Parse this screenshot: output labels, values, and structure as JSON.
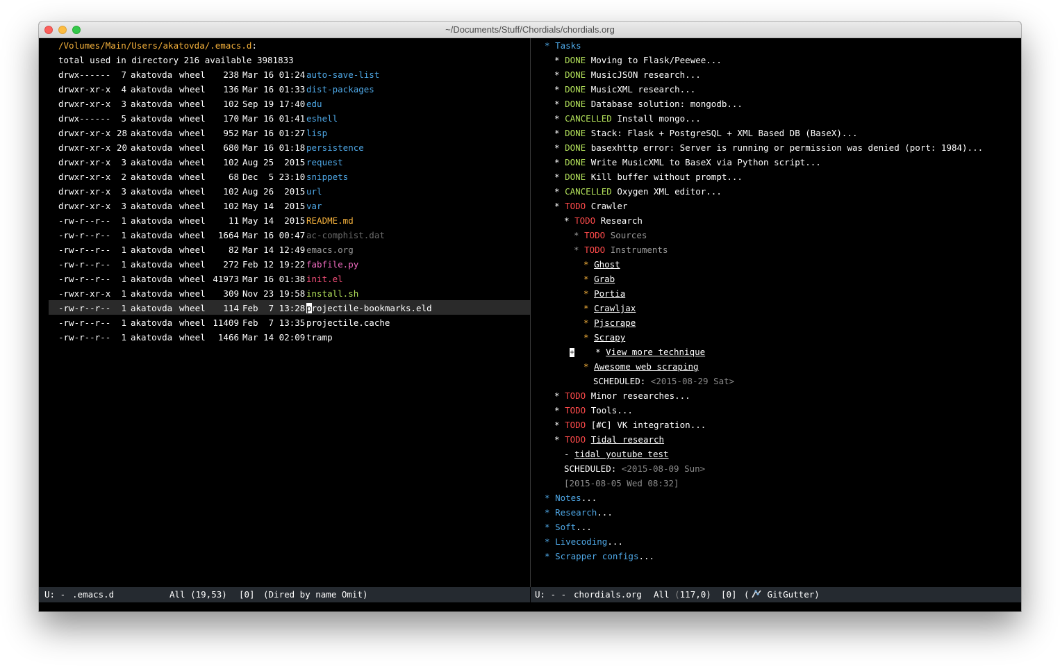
{
  "window": {
    "title": "~/Documents/Stuff/Chordials/chordials.org"
  },
  "dired": {
    "path": "/Volumes/Main/Users/akatovda/.emacs.d",
    "path_colon": ":",
    "summary": "total used in directory 216 available 3981833",
    "rows": [
      {
        "perm": "drwx------",
        "n": "7",
        "owner": "akatovda",
        "group": "wheel",
        "size": "238",
        "date": "Mar 16 01:24",
        "name": "auto-save-list",
        "kind": "dir"
      },
      {
        "perm": "drwxr-xr-x",
        "n": "4",
        "owner": "akatovda",
        "group": "wheel",
        "size": "136",
        "date": "Mar 16 01:33",
        "name": "dist-packages",
        "kind": "dir"
      },
      {
        "perm": "drwxr-xr-x",
        "n": "3",
        "owner": "akatovda",
        "group": "wheel",
        "size": "102",
        "date": "Sep 19 17:40",
        "name": "edu",
        "kind": "dir"
      },
      {
        "perm": "drwx------",
        "n": "5",
        "owner": "akatovda",
        "group": "wheel",
        "size": "170",
        "date": "Mar 16 01:41",
        "name": "eshell",
        "kind": "dir"
      },
      {
        "perm": "drwxr-xr-x",
        "n": "28",
        "owner": "akatovda",
        "group": "wheel",
        "size": "952",
        "date": "Mar 16 01:27",
        "name": "lisp",
        "kind": "dir"
      },
      {
        "perm": "drwxr-xr-x",
        "n": "20",
        "owner": "akatovda",
        "group": "wheel",
        "size": "680",
        "date": "Mar 16 01:18",
        "name": "persistence",
        "kind": "dir"
      },
      {
        "perm": "drwxr-xr-x",
        "n": "3",
        "owner": "akatovda",
        "group": "wheel",
        "size": "102",
        "date": "Aug 25  2015",
        "name": "request",
        "kind": "dir"
      },
      {
        "perm": "drwxr-xr-x",
        "n": "2",
        "owner": "akatovda",
        "group": "wheel",
        "size": "68",
        "date": "Dec  5 23:10",
        "name": "snippets",
        "kind": "dir"
      },
      {
        "perm": "drwxr-xr-x",
        "n": "3",
        "owner": "akatovda",
        "group": "wheel",
        "size": "102",
        "date": "Aug 26  2015",
        "name": "url",
        "kind": "dir"
      },
      {
        "perm": "drwxr-xr-x",
        "n": "3",
        "owner": "akatovda",
        "group": "wheel",
        "size": "102",
        "date": "May 14  2015",
        "name": "var",
        "kind": "dir"
      },
      {
        "perm": "-rw-r--r--",
        "n": "1",
        "owner": "akatovda",
        "group": "wheel",
        "size": "11",
        "date": "May 14  2015",
        "name": "README.md",
        "kind": "md"
      },
      {
        "perm": "-rw-r--r--",
        "n": "1",
        "owner": "akatovda",
        "group": "wheel",
        "size": "1664",
        "date": "Mar 16 00:47",
        "name": "ac-comphist.dat",
        "kind": "dim"
      },
      {
        "perm": "-rw-r--r--",
        "n": "1",
        "owner": "akatovda",
        "group": "wheel",
        "size": "82",
        "date": "Mar 14 12:49",
        "name": "emacs.org",
        "kind": "org-file"
      },
      {
        "perm": "-rw-r--r--",
        "n": "1",
        "owner": "akatovda",
        "group": "wheel",
        "size": "272",
        "date": "Feb 12 19:22",
        "name": "fabfile.py",
        "kind": "py"
      },
      {
        "perm": "-rw-r--r--",
        "n": "1",
        "owner": "akatovda",
        "group": "wheel",
        "size": "41973",
        "date": "Mar 16 01:38",
        "name": "init.el",
        "kind": "el"
      },
      {
        "perm": "-rwxr-xr-x",
        "n": "1",
        "owner": "akatovda",
        "group": "wheel",
        "size": "309",
        "date": "Nov 23 19:58",
        "name": "install.sh",
        "kind": "sh"
      },
      {
        "perm": "-rw-r--r--",
        "n": "1",
        "owner": "akatovda",
        "group": "wheel",
        "size": "114",
        "date": "Feb  7 13:28",
        "name": "projectile-bookmarks.eld",
        "kind": "plain"
      },
      {
        "perm": "-rw-r--r--",
        "n": "1",
        "owner": "akatovda",
        "group": "wheel",
        "size": "11409",
        "date": "Feb  7 13:35",
        "name": "projectile.cache",
        "kind": "plain"
      },
      {
        "perm": "-rw-r--r--",
        "n": "1",
        "owner": "akatovda",
        "group": "wheel",
        "size": "1466",
        "date": "Mar 14 02:09",
        "name": "tramp",
        "kind": "plain"
      }
    ],
    "cursor_row": 16,
    "cursor_first_char": "p",
    "cursor_rest": "rojectile-bookmarks.eld"
  },
  "org": {
    "tasks": "Tasks",
    "star": "*",
    "ellipsis": "...",
    "items": [
      {
        "kw": "DONE",
        "text": "Moving to Flask/Peewee..."
      },
      {
        "kw": "DONE",
        "text": "MusicJSON research..."
      },
      {
        "kw": "DONE",
        "text": "MusicXML research..."
      },
      {
        "kw": "DONE",
        "text": "Database solution: mongodb..."
      },
      {
        "kw": "CANCELLED",
        "text": "Install mongo..."
      },
      {
        "kw": "DONE",
        "text": "Stack: Flask + PostgreSQL + XML Based DB (BaseX)..."
      },
      {
        "kw": "DONE",
        "text": "basexhttp error: Server is running or permission was denied (port: 1984)..."
      },
      {
        "kw": "DONE",
        "text": "Write MusicXML to BaseX via Python script..."
      },
      {
        "kw": "DONE",
        "text": "Kill buffer without prompt..."
      },
      {
        "kw": "CANCELLED",
        "text": "Oxygen XML editor..."
      }
    ],
    "crawler": {
      "kw": "TODO",
      "text": "Crawler"
    },
    "research": {
      "kw": "TODO",
      "text": "Research"
    },
    "sources": {
      "kw": "TODO",
      "text": "Sources"
    },
    "instruments": {
      "kw": "TODO",
      "text": "Instruments"
    },
    "tools": [
      "Ghost",
      "Grab",
      "Portia",
      "Crawljax",
      "Pjscrape",
      "Scrapy"
    ],
    "marker": "+",
    "view_more": "View more technique",
    "awesome": "Awesome web scraping",
    "scheduled_label": "SCHEDULED:",
    "scheduled1": "<2015-08-29 Sat>",
    "minor": {
      "kw": "TODO",
      "text": "Minor researches..."
    },
    "tools_item": {
      "kw": "TODO",
      "text": "Tools..."
    },
    "vk": {
      "kw": "TODO",
      "text": "[#C] VK integration..."
    },
    "tidal": {
      "kw": "TODO",
      "text": "Tidal research"
    },
    "dash": "-",
    "tidal_sub": "tidal youtube test",
    "scheduled2": "<2015-08-09 Sun>",
    "inactive_ts": "[2015-08-05 Wed 08:32]",
    "sections": [
      "Notes",
      "Research",
      "Soft",
      "Livecoding",
      "Scrapper configs"
    ]
  },
  "modeline_left": {
    "state": "U: -",
    "buffer": ".emacs.d",
    "pos": "All (19,53)",
    "count": "[0]",
    "mode": "(Dired by name Omit)"
  },
  "modeline_right": {
    "state": "U: - -",
    "buffer": "chordials.org",
    "pos": "All ",
    "pos_cursor": "(",
    "pos_rest": "117,0)",
    "count": "[0]",
    "mode_open": "(",
    "mode": "GitGutter)"
  },
  "colors": {
    "directory": "#4fa9e8",
    "done": "#b2e05a",
    "todo": "#ff4b4b",
    "heading_star": "#f6b23c",
    "modeline_bg": "#252a30"
  }
}
